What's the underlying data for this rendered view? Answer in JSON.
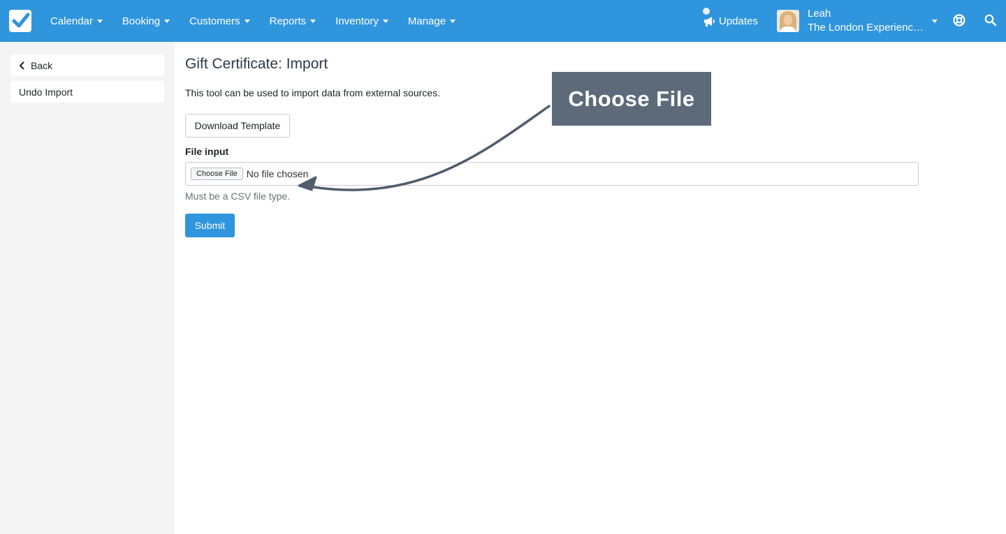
{
  "nav": {
    "items": [
      {
        "label": "Calendar"
      },
      {
        "label": "Booking"
      },
      {
        "label": "Customers"
      },
      {
        "label": "Reports"
      },
      {
        "label": "Inventory"
      },
      {
        "label": "Manage"
      }
    ],
    "updates_label": "Updates",
    "user_name": "Leah",
    "user_org": "The London Experienc…"
  },
  "sidebar": {
    "back_label": "Back",
    "undo_label": "Undo Import"
  },
  "main": {
    "title": "Gift Certificate: Import",
    "description": "This tool can be used to import data from external sources.",
    "download_label": "Download Template",
    "file_label": "File input",
    "file_button": "Choose File",
    "file_status": "No file chosen",
    "help_text": "Must be a CSV file type.",
    "submit_label": "Submit"
  },
  "annotation": {
    "callout_text": "Choose File"
  },
  "colors": {
    "brand": "#2f95dc",
    "callout": "#5c6a79"
  }
}
